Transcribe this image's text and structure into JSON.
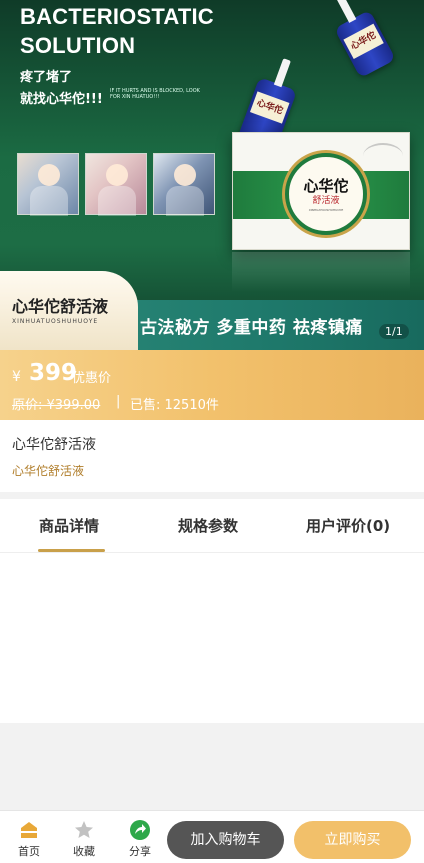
{
  "banner": {
    "title_en_1": "BACTERIOSTATIC",
    "title_en_2": "SOLUTION",
    "slogan_1": "疼了堵了",
    "slogan_2": "就找心华佗!!!",
    "slogan_en": "IF IT HURTS AND IS BLOCKED, LOOK FOR XIN HUATUO!!!",
    "bottle_label": "心华佗",
    "box_title": "心华佗",
    "box_subtitle": "舒活液",
    "box_small": "XINHUATUOSHUHUOYE",
    "product_name": "心华佗舒活液",
    "product_pinyin": "XINHUATUOSHUHUOYE",
    "ribbon_text": "古法秘方 多重中药 祛疼镇痛",
    "pager": "1/1"
  },
  "price": {
    "currency": "¥",
    "amount": "399",
    "tag": "优惠价",
    "original": "原价: ¥399.00",
    "separator": "|",
    "sold": "已售: 12510件"
  },
  "product": {
    "title": "心华佗舒活液",
    "subtitle": "心华佗舒活液"
  },
  "tabs": [
    {
      "label": "商品详情",
      "active": true
    },
    {
      "label": "规格参数",
      "active": false
    },
    {
      "label": "用户评价(0)",
      "active": false
    }
  ],
  "bottom_nav": {
    "home": "首页",
    "favorite": "收藏",
    "share": "分享",
    "add_to_cart": "加入购物车",
    "buy_now": "立即购买"
  },
  "colors": {
    "accent_gold": "#c9a04a",
    "price_strip": "#f2c16c",
    "buy_button": "#f2c06a",
    "cart_button": "#555555",
    "banner_green": "#1b6b43"
  },
  "icons": [
    "home-icon",
    "star-icon",
    "share-icon"
  ]
}
